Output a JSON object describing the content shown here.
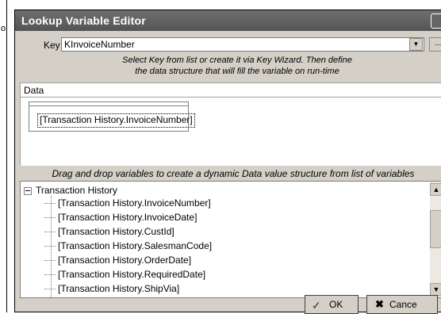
{
  "left_strip": {
    "mark": "o"
  },
  "dialog": {
    "title": "Lookup Variable Editor"
  },
  "key": {
    "label": "Key",
    "value": "KInvoiceNumber",
    "dropdown_icon": "chevron-down-icon",
    "extra_button": "..."
  },
  "hint": {
    "line1": "Select Key from list or create it via Key Wizard. Then define",
    "line2": "the data structure that will fill the variable on run-time"
  },
  "data": {
    "label": "Data",
    "token": "[Transaction History.InvoiceNumber]"
  },
  "drag_hint": "Drag and drop variables to create a dynamic Data value structure from list of variables",
  "tree": {
    "root": "Transaction History",
    "children": [
      "[Transaction History.InvoiceNumber]",
      "[Transaction History.InvoiceDate]",
      "[Transaction History.CustId]",
      "[Transaction History.SalesmanCode]",
      "[Transaction History.OrderDate]",
      "[Transaction History.RequiredDate]",
      "[Transaction History.ShipVia]"
    ]
  },
  "buttons": {
    "ok": "OK",
    "cancel": "Cance"
  }
}
